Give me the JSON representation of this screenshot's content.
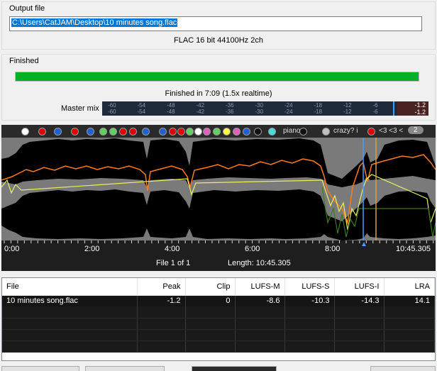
{
  "output_file": {
    "title": "Output file",
    "path": "C:\\Users\\CatJAM\\Desktop\\10 minutes song.flac",
    "format": "FLAC 16 bit 44100Hz 2ch"
  },
  "status": {
    "title": "Finished",
    "progress_fraction": 1.0,
    "finished_text": "Finished in 7:09   (1.5x realtime)",
    "meter_label": "Master mix",
    "meter_scale": [
      "-60",
      "-54",
      "-48",
      "-42",
      "-36",
      "-30",
      "-24",
      "-18",
      "-12",
      "-6"
    ],
    "peak_values": [
      "-1.2",
      "-1.2"
    ]
  },
  "markers": {
    "dot_colors": [
      "#ffffff",
      "#e00000",
      "#2060d0",
      "#e00000",
      "#2060d0",
      "#60d060",
      "#60d060",
      "#e00000",
      "#e00000",
      "#2060d0",
      "#2060d0",
      "#e00000",
      "#e00000",
      "#60d060",
      "#ffffff",
      "#e060c0",
      "#60d060",
      "#ffff40",
      "#e060c0",
      "#2060d0",
      "#111111",
      "#40e0e0",
      "#111111",
      "#e00000",
      "#c0c0c0"
    ],
    "label_piano": "piano",
    "label_crazy": "crazy? i",
    "label_hearts": "<3 <3 <",
    "counter": "2"
  },
  "timeline": {
    "ticks": [
      "0:00",
      "2:00",
      "4:00",
      "6:00",
      "8:00",
      "10:45.305"
    ]
  },
  "file_info": {
    "file_count": "File 1 of 1",
    "length": "Length: 10:45.305"
  },
  "results": {
    "columns": [
      "File",
      "Peak",
      "Clip",
      "LUFS-M",
      "LUFS-S",
      "LUFS-I",
      "LRA"
    ],
    "rows": [
      [
        "10 minutes song.flac",
        "-1.2",
        "0",
        "-8.6",
        "-10.3",
        "-14.3",
        "14.1"
      ]
    ]
  }
}
